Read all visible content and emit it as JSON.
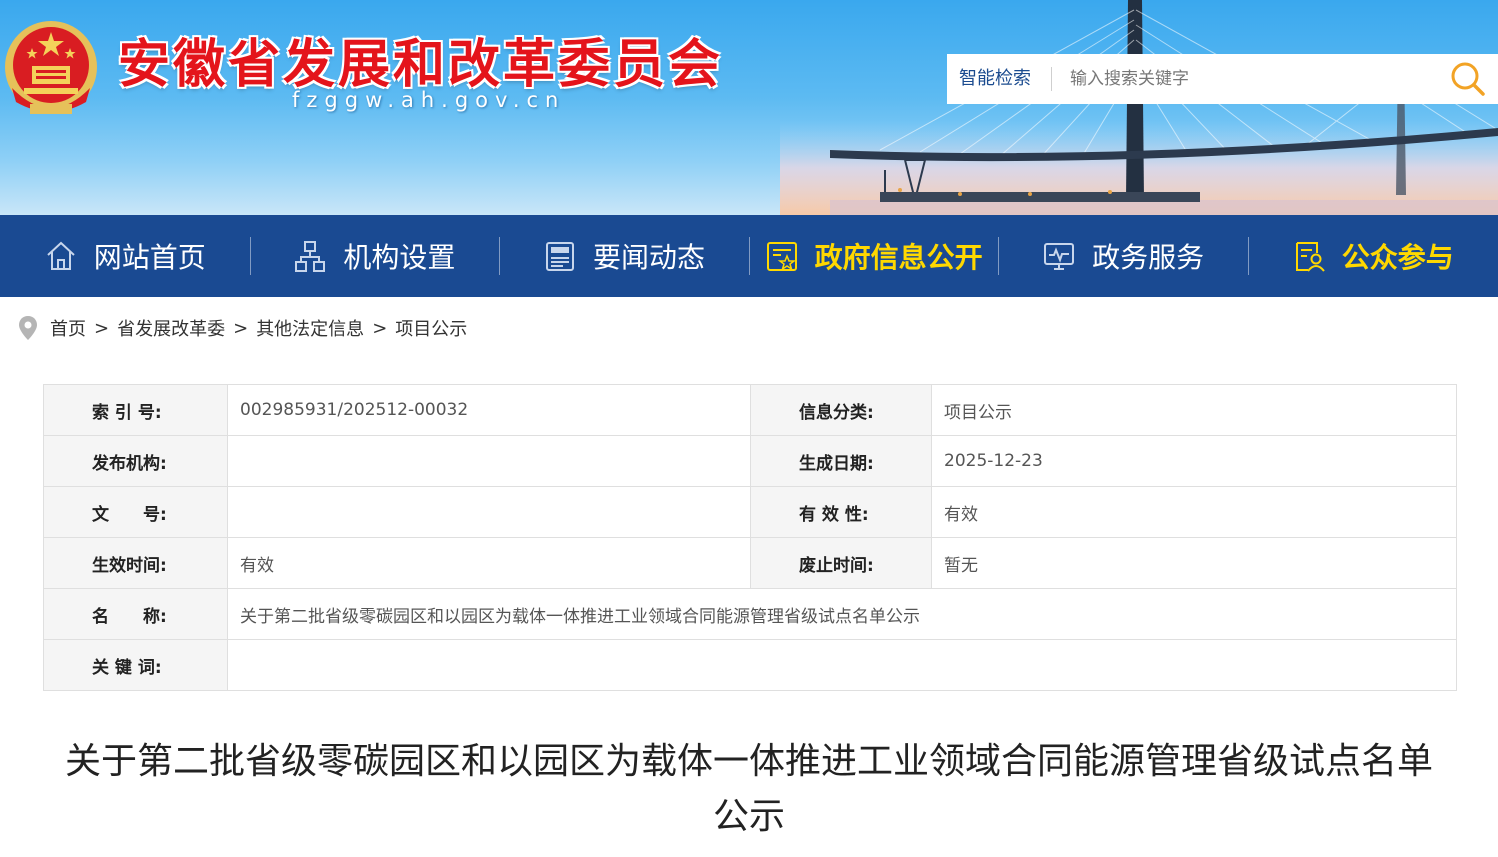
{
  "header": {
    "site_title": "安徽省发展和改革委员会",
    "site_domain": "fzggw.ah.gov.cn",
    "search": {
      "label": "智能检索",
      "placeholder": "输入搜索关键字"
    }
  },
  "nav": {
    "items": [
      {
        "label": "网站首页",
        "icon": "home-icon"
      },
      {
        "label": "机构设置",
        "icon": "org-chart-icon"
      },
      {
        "label": "要闻动态",
        "icon": "news-icon"
      },
      {
        "label": "政府信息公开",
        "icon": "info-disclosure-icon"
      },
      {
        "label": "政务服务",
        "icon": "monitor-icon"
      },
      {
        "label": "公众参与",
        "icon": "public-participation-icon"
      }
    ],
    "highlight_color": "#ffd800",
    "bar_color": "#1a4a92"
  },
  "breadcrumb": {
    "items": [
      "首页",
      "省发展改革委",
      "其他法定信息",
      "项目公示"
    ],
    "separator": ">"
  },
  "info": {
    "index_no": {
      "label": "索 引 号:",
      "value": "002985931/202512-00032"
    },
    "category": {
      "label": "信息分类:",
      "value": "项目公示"
    },
    "publisher": {
      "label": "发布机构:",
      "value": ""
    },
    "created": {
      "label": "生成日期:",
      "value": "2025-12-23"
    },
    "doc_no": {
      "label": "文　　号:",
      "value": ""
    },
    "validity": {
      "label": "有 效 性:",
      "value": "有效"
    },
    "effective": {
      "label": "生效时间:",
      "value": "有效"
    },
    "abolished": {
      "label": "废止时间:",
      "value": "暂无"
    },
    "name": {
      "label": "名　　称:",
      "value": "关于第二批省级零碳园区和以园区为载体一体推进工业领域合同能源管理省级试点名单公示"
    },
    "keywords": {
      "label": "关 键 词:",
      "value": ""
    }
  },
  "article": {
    "title": "关于第二批省级零碳园区和以园区为载体一体推进工业领域合同能源管理省级试点名单公示"
  }
}
